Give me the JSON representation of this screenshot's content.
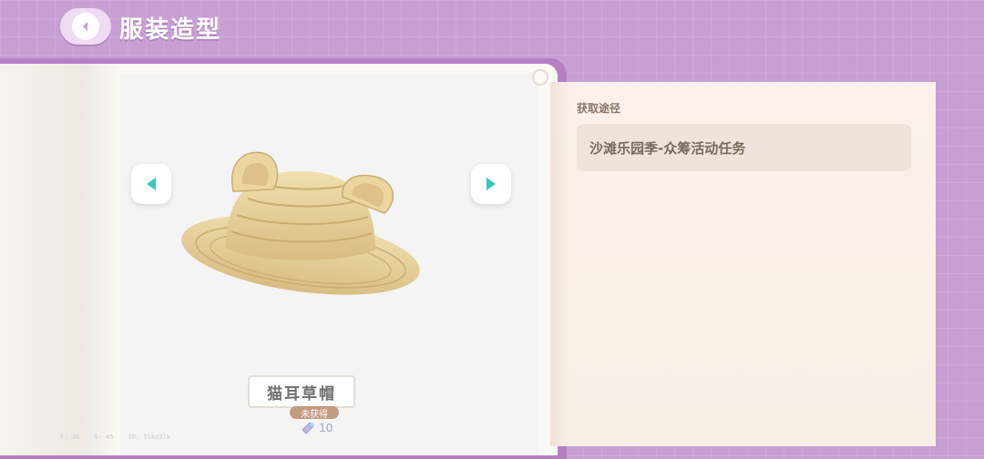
{
  "header": {
    "back_icon": "chevron-left-icon",
    "title": "服装造型"
  },
  "viewer": {
    "prev_icon": "arrow-left-icon",
    "next_icon": "arrow-right-icon",
    "item_name": "猫耳草帽",
    "status": "未获得",
    "points_icon": "sparkle-ticket-icon",
    "points_value": "10"
  },
  "debug": {
    "fps": "F: 30",
    "s": "S: 45",
    "id": "ID: 5lko3lk"
  },
  "acquisition": {
    "label": "获取途径",
    "source": "沙滩乐园季-众筹活动任务"
  },
  "colors": {
    "background": "#c79fd3",
    "book_edge": "#b67fc4",
    "arrow_accent": "#3cc6c0",
    "status_tag": "#c39a82",
    "panel_bg": "#fbf1ea"
  }
}
